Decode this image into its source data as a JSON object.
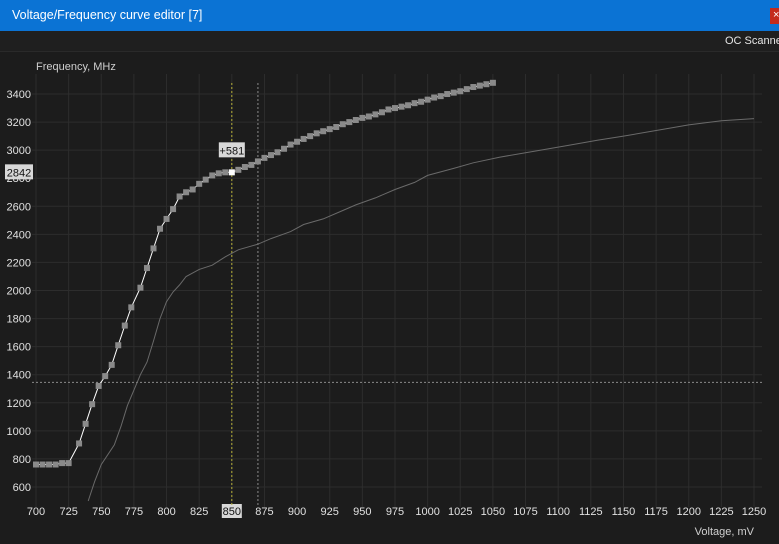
{
  "window": {
    "title": "Voltage/Frequency curve editor [7]",
    "close_glyph": "×",
    "colors": {
      "titlebar": "#0b73d4",
      "background": "#1c1c1c",
      "close": "#c42b1c"
    }
  },
  "toolbar": {
    "oc_scanner_label": "OC Scanner"
  },
  "chart_data": {
    "type": "line",
    "ylabel": "Frequency, MHz",
    "xlabel": "Voltage, mV",
    "xlim": [
      700,
      1250
    ],
    "ylim": [
      500,
      3500
    ],
    "x_ticks": [
      "700",
      "725",
      "750",
      "775",
      "800",
      "825",
      "850",
      "875",
      "900",
      "925",
      "950",
      "975",
      "1000",
      "1025",
      "1050",
      "1075",
      "1100",
      "1125",
      "1150",
      "1175",
      "1200",
      "1225",
      "1250"
    ],
    "y_ticks": [
      "600",
      "800",
      "1000",
      "1200",
      "1400",
      "1600",
      "1800",
      "2000",
      "2200",
      "2400",
      "2600",
      "2800",
      "3000",
      "3200",
      "3400"
    ],
    "grid": true,
    "highlighted_x": "850",
    "current_freq_label": "2842",
    "offset_label": "+581",
    "cursor": {
      "voltage": 850,
      "hover_voltage": 870,
      "hover_freq": 1345
    },
    "series": [
      {
        "role": "curve",
        "color": "#ffffff",
        "marker_color": "#8a8a8a",
        "points": [
          [
            700,
            760
          ],
          [
            705,
            760
          ],
          [
            710,
            760
          ],
          [
            715,
            760
          ],
          [
            720,
            770
          ],
          [
            725,
            770
          ],
          [
            733,
            910
          ],
          [
            738,
            1050
          ],
          [
            743,
            1190
          ],
          [
            748,
            1320
          ],
          [
            753,
            1390
          ],
          [
            758,
            1470
          ],
          [
            763,
            1610
          ],
          [
            768,
            1750
          ],
          [
            773,
            1880
          ],
          [
            780,
            2020
          ],
          [
            785,
            2160
          ],
          [
            790,
            2300
          ],
          [
            795,
            2440
          ],
          [
            800,
            2510
          ],
          [
            805,
            2580
          ],
          [
            810,
            2670
          ],
          [
            815,
            2700
          ],
          [
            820,
            2720
          ],
          [
            825,
            2760
          ],
          [
            830,
            2790
          ],
          [
            835,
            2820
          ],
          [
            840,
            2835
          ],
          [
            845,
            2842
          ],
          [
            850,
            2842
          ],
          [
            855,
            2860
          ],
          [
            860,
            2880
          ],
          [
            865,
            2895
          ],
          [
            870,
            2920
          ],
          [
            875,
            2945
          ],
          [
            880,
            2965
          ],
          [
            885,
            2985
          ],
          [
            890,
            3010
          ],
          [
            895,
            3040
          ],
          [
            900,
            3060
          ],
          [
            905,
            3080
          ],
          [
            910,
            3100
          ],
          [
            915,
            3120
          ],
          [
            920,
            3135
          ],
          [
            925,
            3150
          ],
          [
            930,
            3165
          ],
          [
            935,
            3185
          ],
          [
            940,
            3200
          ],
          [
            945,
            3215
          ],
          [
            950,
            3230
          ],
          [
            955,
            3240
          ],
          [
            960,
            3255
          ],
          [
            965,
            3270
          ],
          [
            970,
            3290
          ],
          [
            975,
            3300
          ],
          [
            980,
            3310
          ],
          [
            985,
            3320
          ],
          [
            990,
            3335
          ],
          [
            995,
            3345
          ],
          [
            1000,
            3360
          ],
          [
            1005,
            3375
          ],
          [
            1010,
            3385
          ],
          [
            1015,
            3400
          ],
          [
            1020,
            3410
          ],
          [
            1025,
            3420
          ],
          [
            1030,
            3435
          ],
          [
            1035,
            3450
          ],
          [
            1040,
            3460
          ],
          [
            1045,
            3470
          ],
          [
            1050,
            3480
          ]
        ]
      },
      {
        "role": "default_curve",
        "color": "#6a6a6a",
        "points": [
          [
            740,
            500
          ],
          [
            745,
            640
          ],
          [
            750,
            760
          ],
          [
            760,
            900
          ],
          [
            765,
            1030
          ],
          [
            770,
            1180
          ],
          [
            780,
            1400
          ],
          [
            785,
            1490
          ],
          [
            790,
            1640
          ],
          [
            795,
            1800
          ],
          [
            800,
            1920
          ],
          [
            805,
            1990
          ],
          [
            810,
            2040
          ],
          [
            815,
            2100
          ],
          [
            825,
            2150
          ],
          [
            835,
            2180
          ],
          [
            845,
            2240
          ],
          [
            855,
            2290
          ],
          [
            870,
            2330
          ],
          [
            880,
            2370
          ],
          [
            895,
            2420
          ],
          [
            905,
            2470
          ],
          [
            920,
            2510
          ],
          [
            935,
            2570
          ],
          [
            945,
            2610
          ],
          [
            960,
            2660
          ],
          [
            975,
            2720
          ],
          [
            990,
            2770
          ],
          [
            1000,
            2820
          ],
          [
            1020,
            2870
          ],
          [
            1035,
            2910
          ],
          [
            1055,
            2950
          ],
          [
            1080,
            2990
          ],
          [
            1105,
            3030
          ],
          [
            1130,
            3070
          ],
          [
            1150,
            3100
          ],
          [
            1175,
            3140
          ],
          [
            1200,
            3180
          ],
          [
            1225,
            3210
          ],
          [
            1250,
            3225
          ]
        ]
      }
    ]
  }
}
